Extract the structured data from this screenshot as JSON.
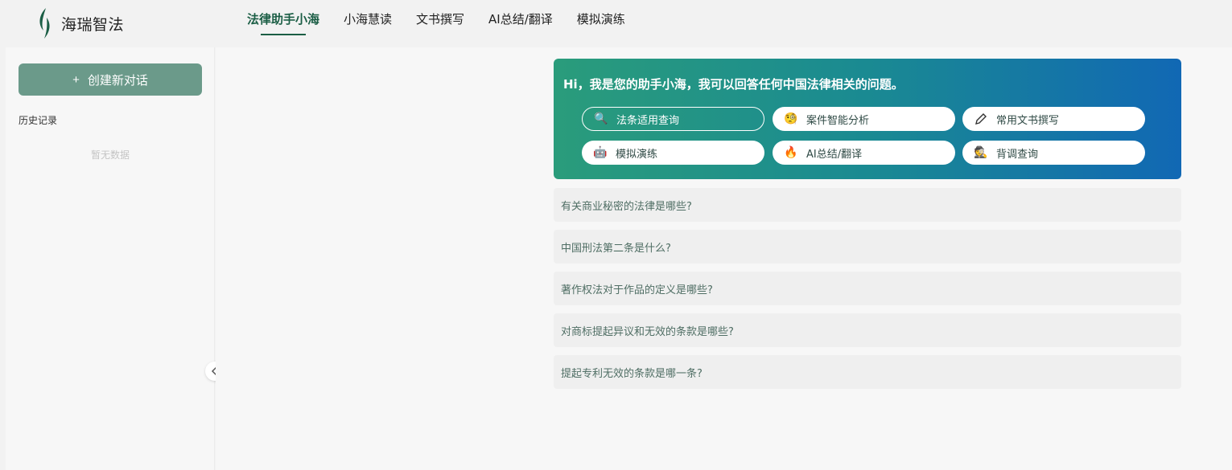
{
  "brand": {
    "name": "海瑞智法",
    "accent": "#1b5e45"
  },
  "nav": [
    {
      "label": "法律助手小海",
      "active": true
    },
    {
      "label": "小海慧读"
    },
    {
      "label": "文书撰写"
    },
    {
      "label": "AI总结/翻译"
    },
    {
      "label": "模拟演练"
    }
  ],
  "sidebar": {
    "new_chat_label": "创建新对话",
    "history_title": "历史记录",
    "empty_text": "暂无数据"
  },
  "hero": {
    "greeting": "Hi，我是您的助手小海，我可以回答任何中国法律相关的问题。",
    "chips": [
      {
        "label": "法条适用查询",
        "icon": "search-icon",
        "glyph": "🔍"
      },
      {
        "label": "案件智能分析",
        "icon": "thinking-face-icon",
        "glyph": "🧐"
      },
      {
        "label": "常用文书撰写",
        "icon": "pen-icon",
        "glyph": ""
      },
      {
        "label": "模拟演练",
        "icon": "robot-icon",
        "glyph": "🤖"
      },
      {
        "label": "AI总结/翻译",
        "icon": "fire-icon",
        "glyph": "🔥"
      },
      {
        "label": "背调查询",
        "icon": "detective-icon",
        "glyph": "🕵"
      }
    ]
  },
  "questions": [
    "有关商业秘密的法律是哪些?",
    "中国刑法第二条是什么?",
    "著作权法对于作品的定义是哪些?",
    "对商标提起异议和无效的条款是哪些?",
    "提起专利无效的条款是哪一条?"
  ]
}
